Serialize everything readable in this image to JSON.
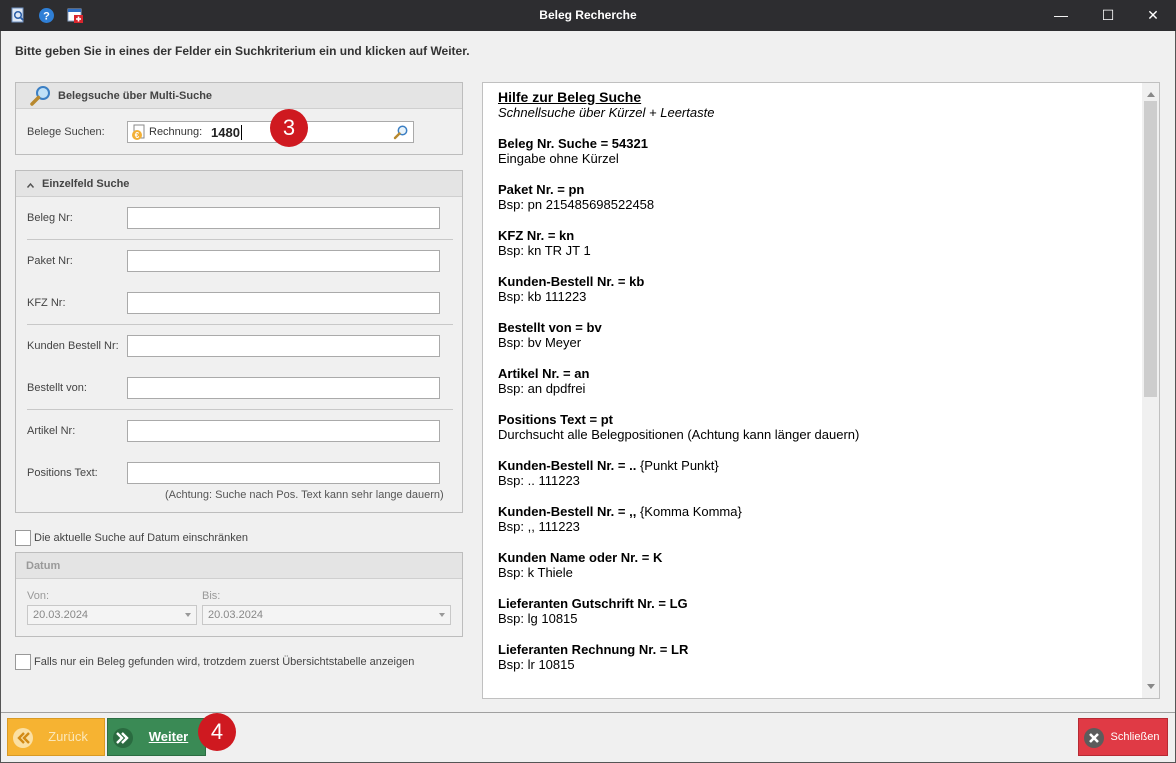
{
  "window": {
    "title": "Beleg Recherche",
    "minimize": "—",
    "maximize": "☐",
    "close": "✕"
  },
  "instruction": "Bitte geben Sie in eines der Felder ein Suchkriterium ein und klicken auf Weiter.",
  "multi_search": {
    "header": "Belegsuche über Multi-Suche",
    "label": "Belege Suchen:",
    "prefix": "Rechnung:",
    "value": "1480"
  },
  "single_search": {
    "header": "Einzelfeld Suche",
    "fields": [
      {
        "label": "Beleg Nr:",
        "value": ""
      },
      {
        "label": "Paket Nr:",
        "value": ""
      },
      {
        "label": "KFZ Nr:",
        "value": ""
      },
      {
        "label": "Kunden Bestell Nr:",
        "value": ""
      },
      {
        "label": "Bestellt von:",
        "value": ""
      },
      {
        "label": "Artikel Nr:",
        "value": ""
      },
      {
        "label": "Positions Text:",
        "value": ""
      }
    ],
    "note": "(Achtung: Suche nach Pos. Text kann sehr lange dauern)"
  },
  "date_filter": {
    "checkbox_label": "Die aktuelle Suche auf Datum einschränken",
    "header": "Datum",
    "from_label": "Von:",
    "from_value": "20.03.2024",
    "to_label": "Bis:",
    "to_value": "20.03.2024"
  },
  "overview_checkbox_label": "Falls nur ein Beleg gefunden wird, trotzdem zuerst Übersichtstabelle anzeigen",
  "help": {
    "title": "Hilfe zur Beleg Suche",
    "subtitle": "Schnellsuche über Kürzel + Leertaste",
    "entries": [
      {
        "head": "Beleg Nr. Suche = 54321",
        "extra": "",
        "text": "Eingabe ohne Kürzel"
      },
      {
        "head": "Paket Nr. = pn",
        "extra": "",
        "text": "Bsp: pn 215485698522458"
      },
      {
        "head": "KFZ Nr. = kn",
        "extra": "",
        "text": "Bsp: kn TR JT 1"
      },
      {
        "head": "Kunden-Bestell Nr. = kb",
        "extra": "",
        "text": "Bsp: kb 111223"
      },
      {
        "head": "Bestellt von = bv",
        "extra": "",
        "text": "Bsp: bv Meyer"
      },
      {
        "head": "Artikel Nr. = an",
        "extra": "",
        "text": "Bsp: an dpdfrei"
      },
      {
        "head": "Positions Text = pt",
        "extra": "",
        "text": "Durchsucht alle Belegpositionen (Achtung kann länger dauern)"
      },
      {
        "head": "Kunden-Bestell Nr. = ..",
        "extra": " {Punkt Punkt}",
        "text": "Bsp: .. 111223"
      },
      {
        "head": "Kunden-Bestell Nr. = ,,",
        "extra": " {Komma Komma}",
        "text": "Bsp: ,, 111223"
      },
      {
        "head": "Kunden Name oder Nr. = K",
        "extra": "",
        "text": "Bsp: k Thiele"
      },
      {
        "head": "Lieferanten Gutschrift Nr. = LG",
        "extra": "",
        "text": "Bsp: lg 10815"
      },
      {
        "head": "Lieferanten Rechnung Nr. = LR",
        "extra": "",
        "text": "Bsp: lr 10815"
      }
    ]
  },
  "buttons": {
    "back": "Zurück",
    "next": "Weiter",
    "close": "Schließen"
  },
  "badges": {
    "step3": "3",
    "step4": "4"
  },
  "colors": {
    "back": "#f6b332",
    "next": "#3a8a55",
    "close": "#e03a45",
    "badge": "#cf1920"
  }
}
